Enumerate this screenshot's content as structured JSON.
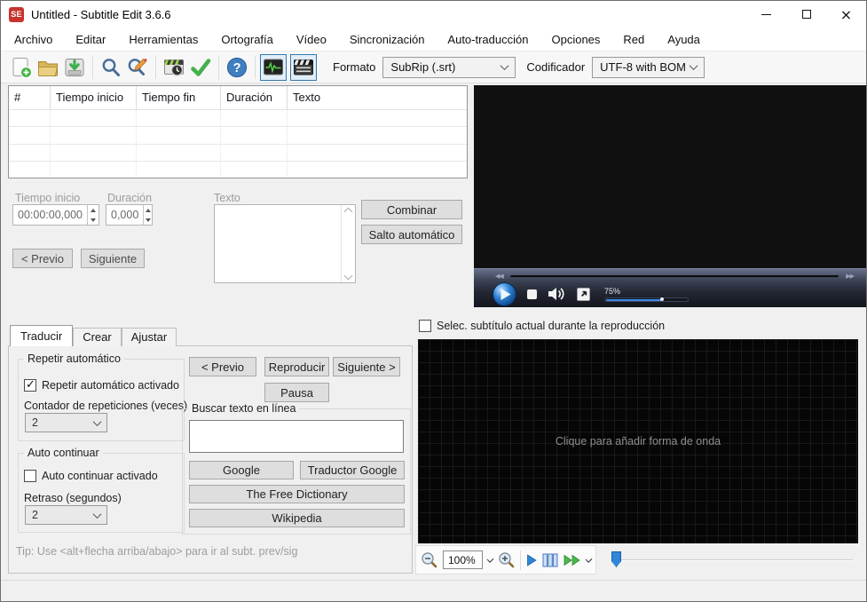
{
  "window": {
    "title": "Untitled - Subtitle Edit 3.6.6",
    "app_icon_text": "SE"
  },
  "menu": {
    "items": [
      "Archivo",
      "Editar",
      "Herramientas",
      "Ortografía",
      "Vídeo",
      "Sincronización",
      "Auto-traducción",
      "Opciones",
      "Red",
      "Ayuda"
    ]
  },
  "toolbar": {
    "icons": [
      "new-file-icon",
      "open-folder-icon",
      "save-icon",
      "find-icon",
      "replace-icon",
      "visual-sync-icon",
      "spell-check-icon",
      "help-icon",
      "waveform-toggle-icon",
      "video-toggle-icon"
    ],
    "format_label": "Formato",
    "format_value": "SubRip (.srt)",
    "encoding_label": "Codificador",
    "encoding_value": "UTF-8 with BOM"
  },
  "subtitle_list": {
    "columns": [
      "#",
      "Tiempo inicio",
      "Tiempo fin",
      "Duración",
      "Texto"
    ],
    "rows": []
  },
  "edit_panel": {
    "start_label": "Tiempo inicio",
    "start_value": "00:00:00,000",
    "duration_label": "Duración",
    "duration_value": "0,000",
    "text_label": "Texto",
    "combine_button": "Combinar",
    "auto_break_button": "Salto automático",
    "prev_button": "< Previo",
    "next_button": "Siguiente"
  },
  "video_player": {
    "rewind_icon": "◀◀",
    "forward_icon": "▶▶",
    "volume_label": "75%"
  },
  "bottom_tabs": {
    "items": [
      "Traducir",
      "Crear",
      "Ajustar"
    ]
  },
  "translate_panel": {
    "auto_repeat_group": "Repetir automático",
    "auto_repeat_checkbox": "Repetir automático activado",
    "repeat_count_label": "Contador de repeticiones (veces)",
    "repeat_count_value": "2",
    "auto_continue_group": "Auto continuar",
    "auto_continue_checkbox": "Auto continuar activado",
    "delay_label": "Retraso (segundos)",
    "delay_value": "2",
    "tip_text": "Tip: Use <alt+flecha arriba/abajo> para ir al subt. prev/sig",
    "prev_button": "< Previo",
    "play_button": "Reproducir",
    "next_button": "Siguiente >",
    "pause_button": "Pausa",
    "search_group": "Buscar texto en línea",
    "search_value": "",
    "google_button": "Google",
    "google_translate_button": "Traductor Google",
    "free_dictionary_button": "The Free Dictionary",
    "wikipedia_button": "Wikipedia"
  },
  "waveform_panel": {
    "select_checkbox": "Selec. subtítulo actual durante la reproducción",
    "placeholder": "Clique para añadir forma de onda",
    "zoom_value": "100%"
  },
  "colors": {
    "accent_blue": "#3086d8",
    "toggle_border": "#3279b0",
    "app_red": "#c9342e",
    "wave_green": "#54d246"
  }
}
